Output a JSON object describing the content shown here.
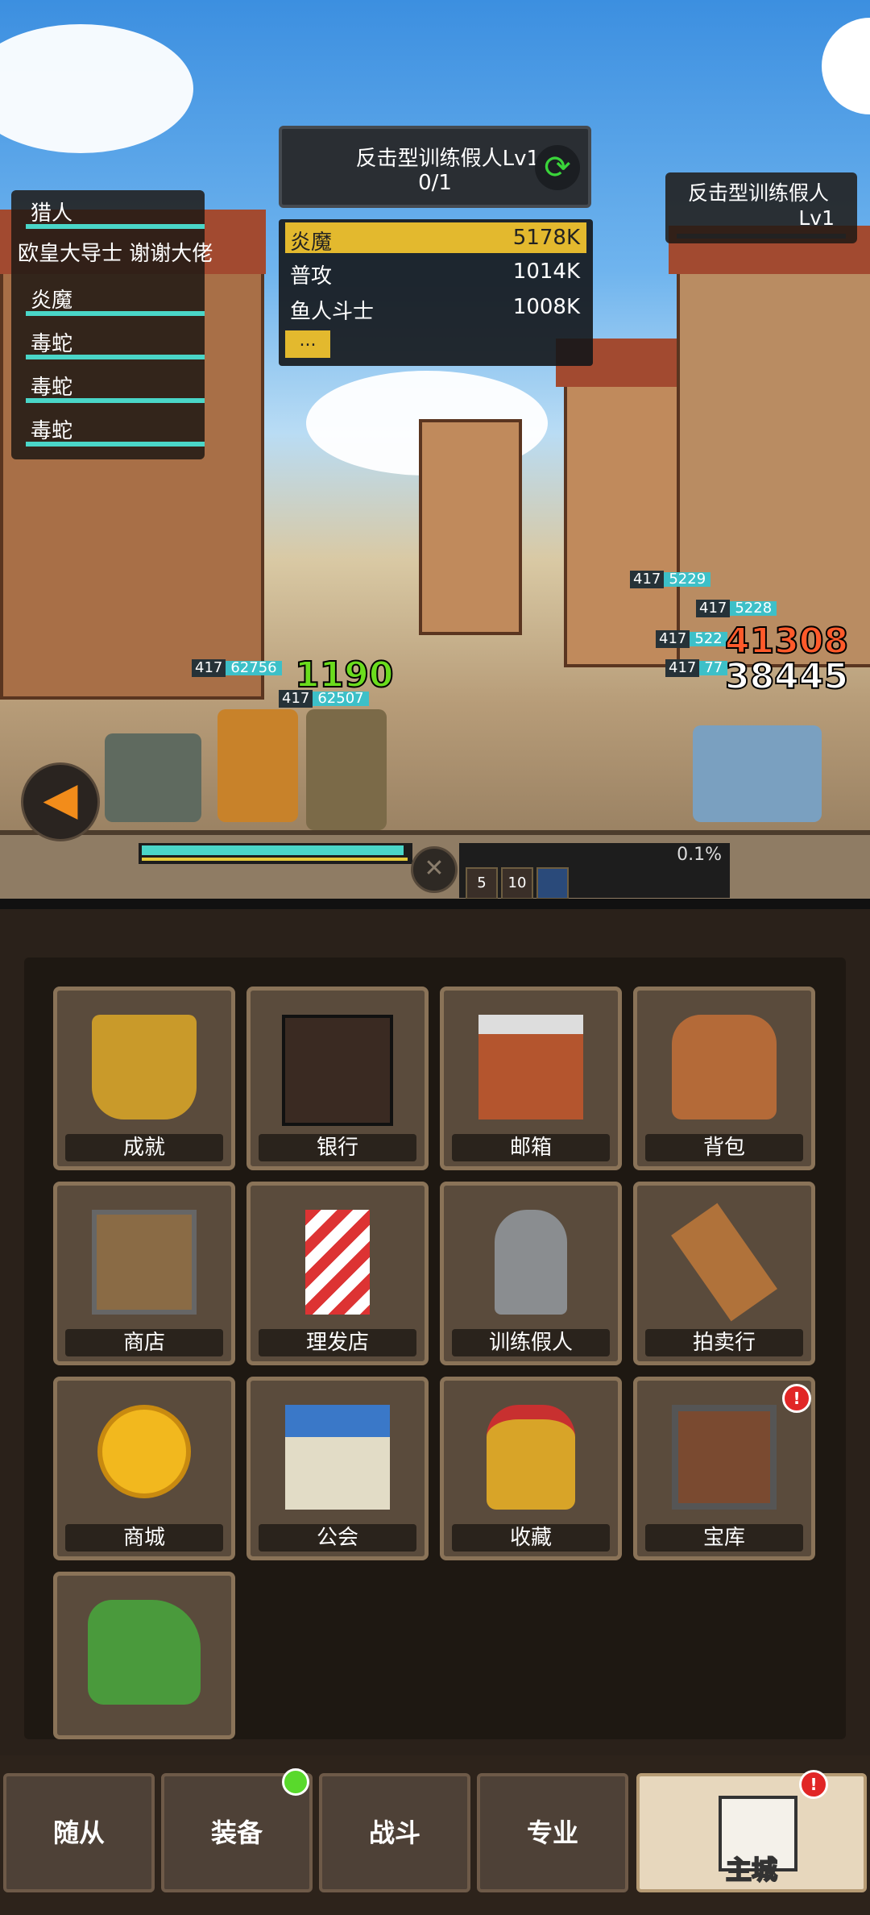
{
  "party": {
    "members": [
      "猎人",
      "炎魔",
      "毒蛇",
      "毒蛇",
      "毒蛇"
    ],
    "overlay_note": "欧皇大导士  谢谢大佬"
  },
  "target": {
    "name": "反击型训练假人Lv1",
    "count": "0/1",
    "cycle_icon": "refresh-icon"
  },
  "damage_list": [
    {
      "name": "炎魔",
      "value": "5178K"
    },
    {
      "name": "普攻",
      "value": "1014K"
    },
    {
      "name": "鱼人斗士",
      "value": "1008K"
    }
  ],
  "damage_more": "...",
  "enemy": {
    "name": "反击型训练假人",
    "level": "Lv1"
  },
  "floating": {
    "ally_hp": [
      {
        "lv": "417",
        "hp": "62756"
      },
      {
        "lv": "417",
        "hp": "62507"
      }
    ],
    "enemy_hp": [
      {
        "lv": "417",
        "hp": "5229"
      },
      {
        "lv": "417",
        "hp": "5228"
      },
      {
        "lv": "417",
        "hp": "522"
      },
      {
        "lv": "417",
        "hp": "77"
      }
    ],
    "damage_green": "1190",
    "damage_red": "41308",
    "damage_white": "38445"
  },
  "battle": {
    "progress_pct": "0.1%",
    "ally_hp_fraction": 0.98,
    "buffs": [
      "5",
      "10",
      ""
    ]
  },
  "grid": [
    {
      "label": "成就",
      "icon": "trophy-icon"
    },
    {
      "label": "银行",
      "icon": "safe-icon"
    },
    {
      "label": "邮箱",
      "icon": "mailbox-icon"
    },
    {
      "label": "背包",
      "icon": "backpack-icon"
    },
    {
      "label": "商店",
      "icon": "chest-icon"
    },
    {
      "label": "理发店",
      "icon": "barber-pole-icon"
    },
    {
      "label": "训练假人",
      "icon": "training-dummy-icon"
    },
    {
      "label": "拍卖行",
      "icon": "gavel-icon"
    },
    {
      "label": "商城",
      "icon": "gold-coin-icon"
    },
    {
      "label": "公会",
      "icon": "guild-house-icon"
    },
    {
      "label": "收藏",
      "icon": "helmet-icon"
    },
    {
      "label": "宝库",
      "icon": "vault-icon",
      "alert": "!"
    },
    {
      "label": "",
      "icon": "dragon-icon"
    }
  ],
  "nav": [
    {
      "label": "随从"
    },
    {
      "label": "装备",
      "dot": true
    },
    {
      "label": "战斗"
    },
    {
      "label": "专业"
    },
    {
      "label": "主城",
      "active": true,
      "alert": "!"
    }
  ],
  "colors": {
    "accent_teal": "#4ad6c8",
    "gold": "#e3b92e",
    "alert_red": "#e12626"
  }
}
